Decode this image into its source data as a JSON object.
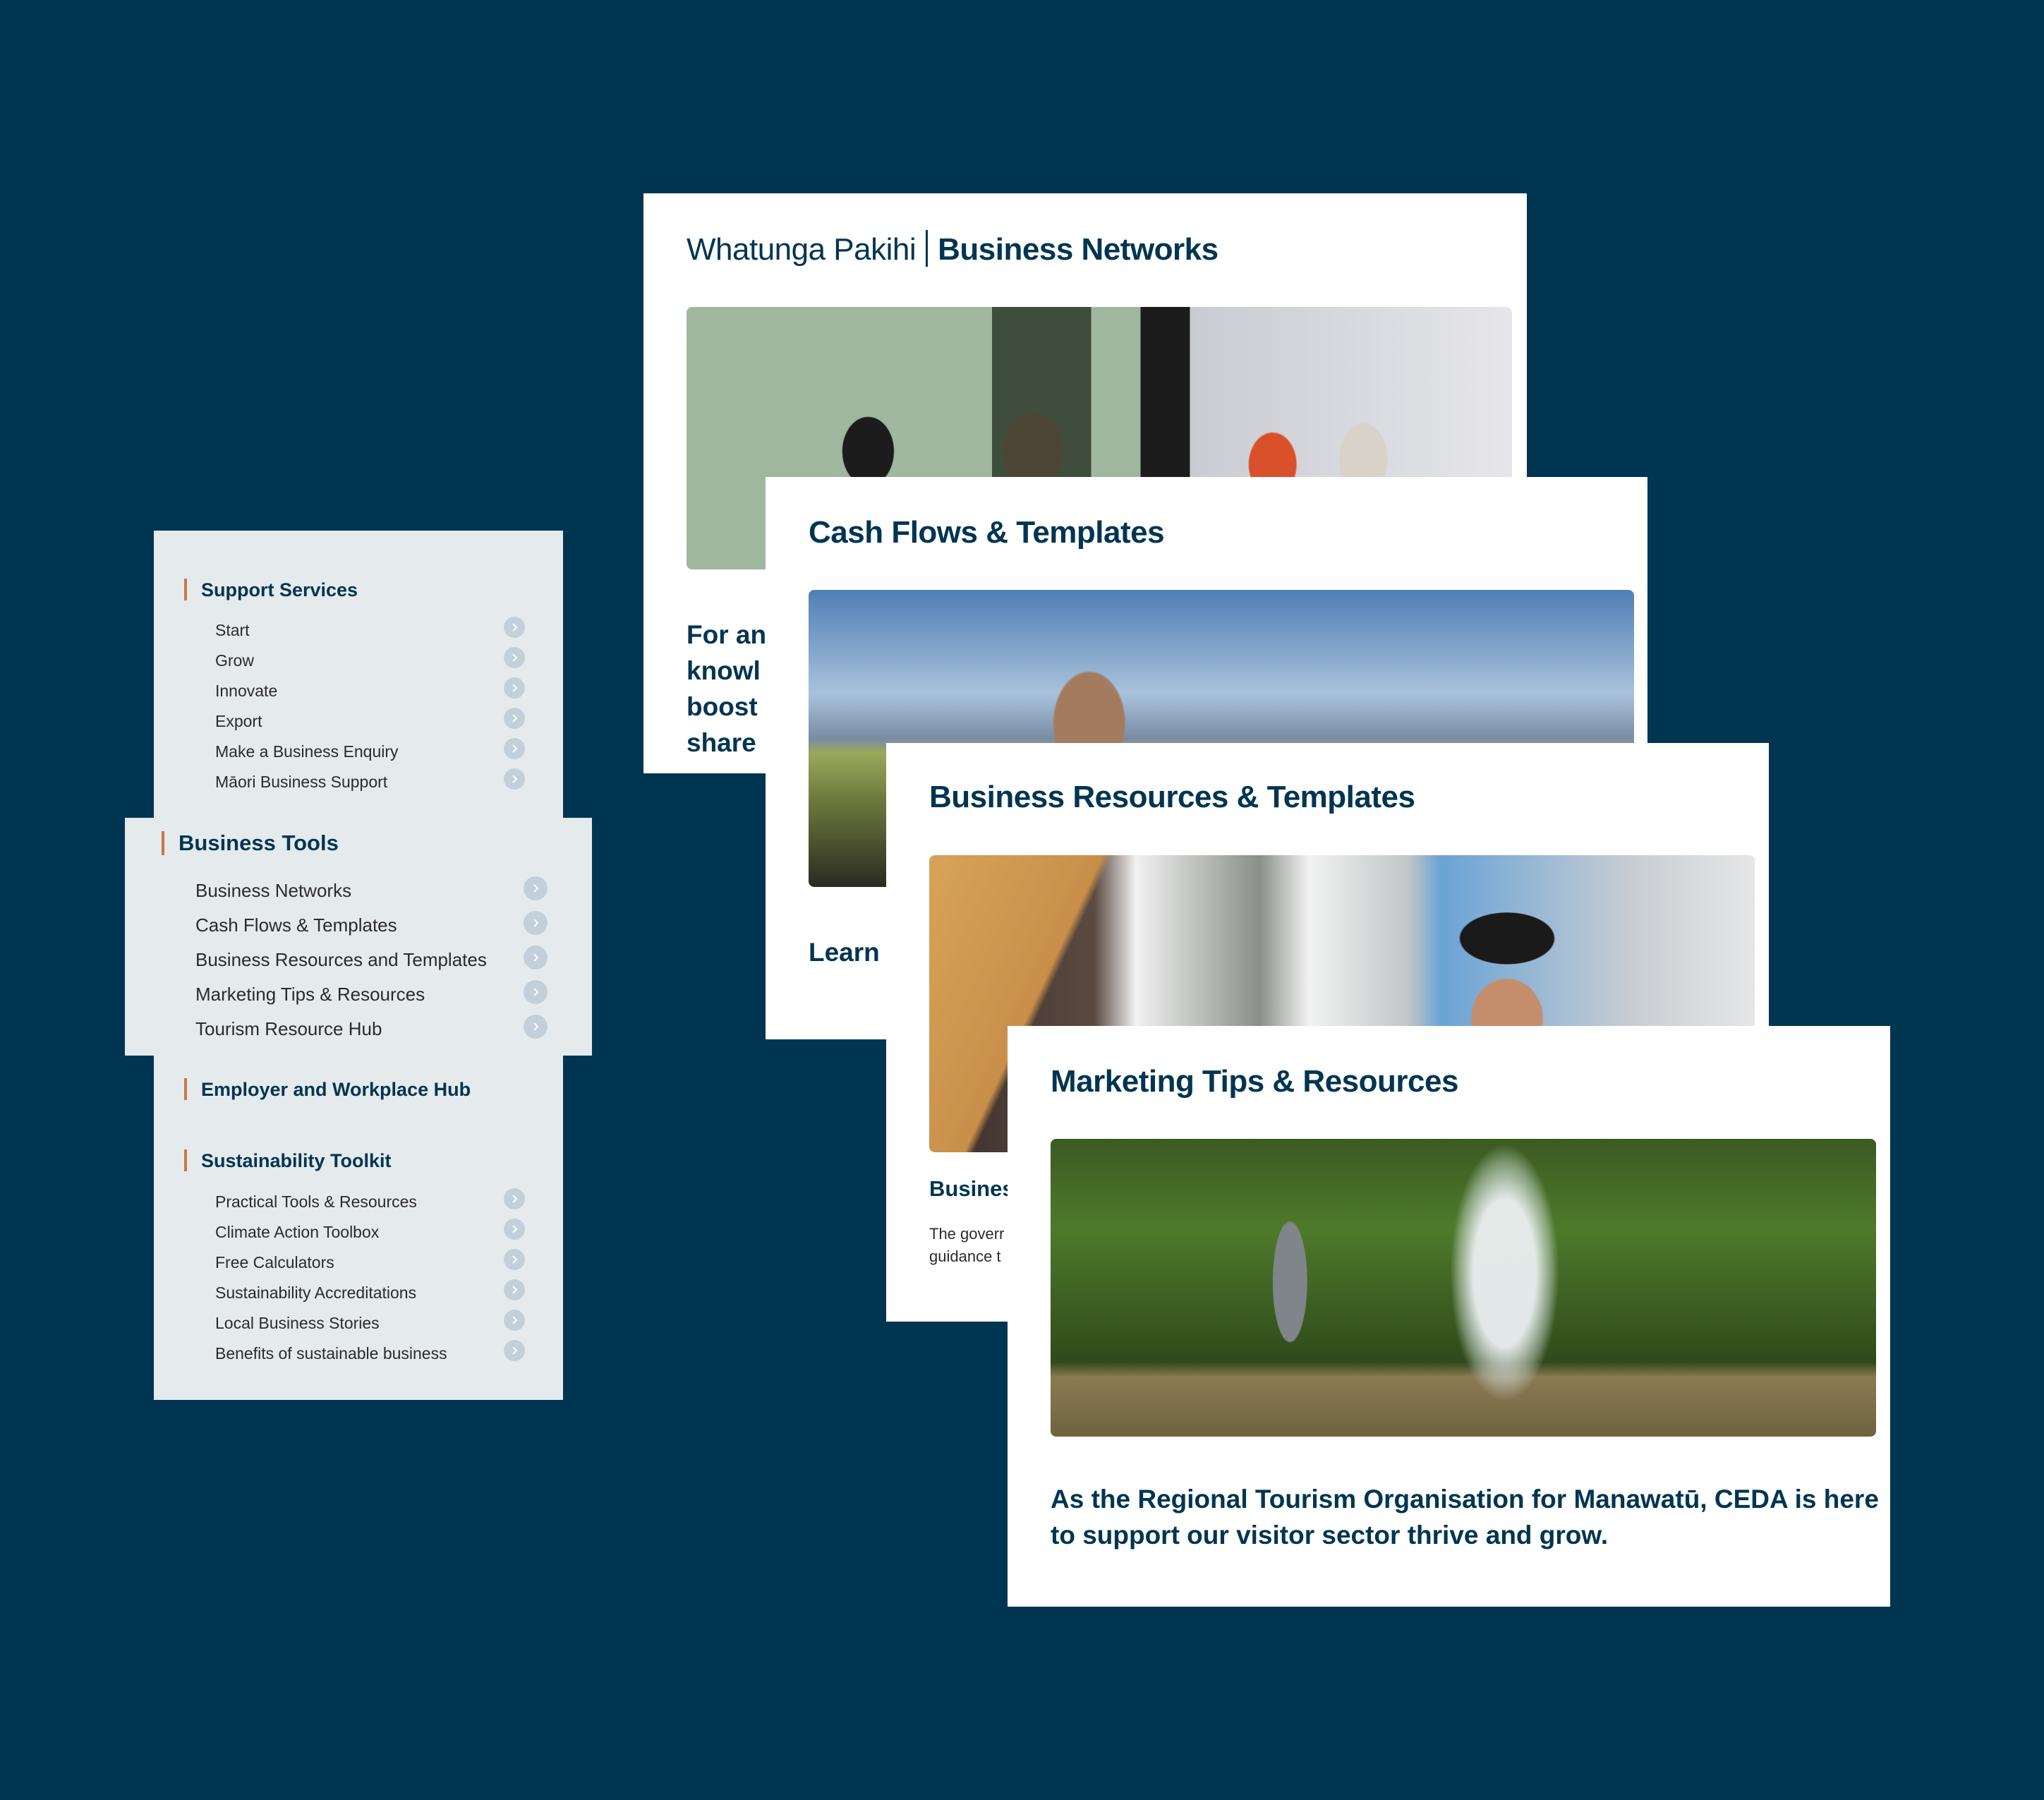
{
  "colors": {
    "background": "#003551",
    "sidebar_bg": "#e5eaed",
    "accent_bar": "#c8784a",
    "heading": "#003551",
    "chevron_bg": "#c3d0da"
  },
  "sidebar": {
    "sections": [
      {
        "title": "Support Services",
        "items": [
          "Start",
          "Grow",
          "Innovate",
          "Export",
          "Make a Business Enquiry",
          "Māori Business Support"
        ]
      },
      {
        "title": "Business Tools",
        "highlighted": true,
        "items": [
          "Business Networks",
          "Cash Flows & Templates",
          "Business Resources and Templates",
          "Marketing Tips & Resources",
          "Tourism Resource Hub"
        ]
      },
      {
        "title": "Employer and Workplace Hub",
        "items": []
      },
      {
        "title": "Sustainability Toolkit",
        "items": [
          "Practical Tools & Resources",
          "Climate Action Toolbox",
          "Free Calculators",
          "Sustainability Accreditations",
          "Local Business Stories",
          "Benefits of sustainable business"
        ]
      }
    ],
    "item_icon": "chevron-right-icon"
  },
  "cards": [
    {
      "title_prefix": "Whatunga Pakihi",
      "title": "Business Networks",
      "image": "people-meeting-photo",
      "body_lines": [
        "For an",
        "knowl",
        "boost",
        "share"
      ]
    },
    {
      "title": "Cash Flows & Templates",
      "image": "farmer-with-cows-photo",
      "body_lines": [
        "Learn"
      ]
    },
    {
      "title": "Business Resources & Templates",
      "image": "bread-handover-photo",
      "subheading": "Busines",
      "body_lines": [
        "The goverr",
        "guidance t"
      ]
    },
    {
      "title": "Marketing Tips & Resources",
      "image": "waterfall-hiker-photo",
      "body_lines": [
        "As the Regional Tourism Organisation for Manawatū, CEDA is here",
        "to support our visitor sector thrive and grow."
      ]
    }
  ]
}
